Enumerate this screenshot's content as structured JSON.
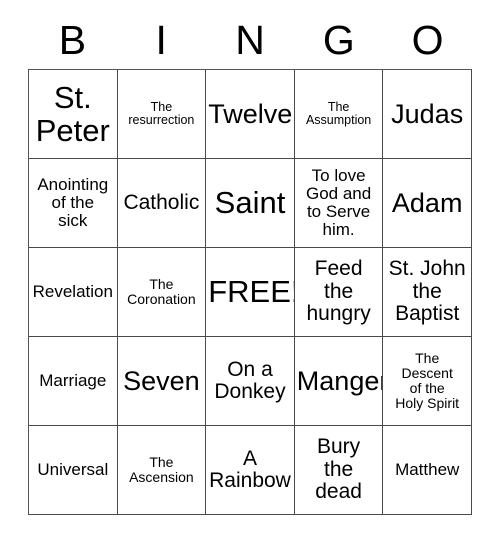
{
  "card": {
    "header_letters": [
      "B",
      "I",
      "N",
      "G",
      "O"
    ],
    "rows": [
      [
        {
          "text": "St.\nPeter",
          "size": "xl"
        },
        {
          "text": "The\nresurrection",
          "size": "xxs"
        },
        {
          "text": "Twelve",
          "size": "lg"
        },
        {
          "text": "The\nAssumption",
          "size": "xxs"
        },
        {
          "text": "Judas",
          "size": "lg"
        }
      ],
      [
        {
          "text": "Anointing\nof the\nsick",
          "size": "sm"
        },
        {
          "text": "Catholic",
          "size": "md"
        },
        {
          "text": "Saint",
          "size": "xl"
        },
        {
          "text": "To love\nGod and\nto Serve\nhim.",
          "size": "sm"
        },
        {
          "text": "Adam",
          "size": "lg"
        }
      ],
      [
        {
          "text": "Revelation",
          "size": "sm"
        },
        {
          "text": "The\nCoronation",
          "size": "xs"
        },
        {
          "text": "FREE!",
          "size": "xl"
        },
        {
          "text": "Feed\nthe\nhungry",
          "size": "md"
        },
        {
          "text": "St. John\nthe\nBaptist",
          "size": "md"
        }
      ],
      [
        {
          "text": "Marriage",
          "size": "sm"
        },
        {
          "text": "Seven",
          "size": "lg"
        },
        {
          "text": "On a\nDonkey",
          "size": "md"
        },
        {
          "text": "Manger",
          "size": "lg"
        },
        {
          "text": "The\nDescent\nof the\nHoly Spirit",
          "size": "xs"
        }
      ],
      [
        {
          "text": "Universal",
          "size": "sm"
        },
        {
          "text": "The\nAscension",
          "size": "xs"
        },
        {
          "text": "A\nRainbow",
          "size": "md"
        },
        {
          "text": "Bury\nthe\ndead",
          "size": "md"
        },
        {
          "text": "Matthew",
          "size": "sm"
        }
      ]
    ]
  },
  "colors": {
    "background": "#ffffff",
    "text": "#000000",
    "grid_line": "#4a4a4a"
  }
}
